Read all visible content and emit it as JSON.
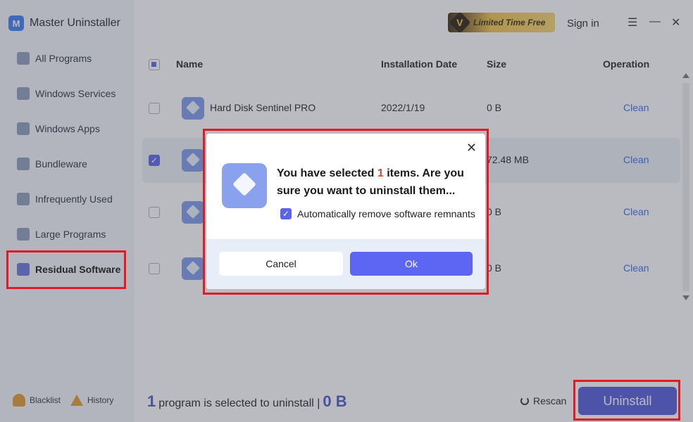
{
  "app": {
    "title": "Master Uninstaller",
    "logo_letter": "M",
    "accent_color": "#5b63e6",
    "highlight_color": "#e01b24"
  },
  "sidebar": {
    "items": [
      {
        "label": "All Programs",
        "icon": "monitor-icon"
      },
      {
        "label": "Windows Services",
        "icon": "windows-icon"
      },
      {
        "label": "Windows Apps",
        "icon": "grid-icon"
      },
      {
        "label": "Bundleware",
        "icon": "link-icon"
      },
      {
        "label": "Infrequently Used",
        "icon": "trash-icon"
      },
      {
        "label": "Large Programs",
        "icon": "folder-icon"
      },
      {
        "label": "Residual Software",
        "icon": "box-icon",
        "active": true
      }
    ],
    "blacklist_label": "Blacklist",
    "history_label": "History"
  },
  "topbar": {
    "promo_badge": "V",
    "promo_label": "Limited Time Free",
    "signin_label": "Sign in",
    "menu_glyph": "☰",
    "minimize_glyph": "—",
    "close_glyph": "✕"
  },
  "table": {
    "columns": {
      "name": "Name",
      "date": "Installation Date",
      "size": "Size",
      "operation": "Operation"
    },
    "rows": [
      {
        "name": "Hard Disk Sentinel PRO",
        "date": "2022/1/19",
        "size": "0 B",
        "action": "Clean",
        "checked": false
      },
      {
        "name": "",
        "date": "",
        "size": "72.48 MB",
        "action": "Clean",
        "checked": true
      },
      {
        "name": "",
        "date": "",
        "size": "0 B",
        "action": "Clean",
        "checked": false
      },
      {
        "name": "",
        "date": "",
        "size": "0 B",
        "action": "Clean",
        "checked": false
      }
    ]
  },
  "footer": {
    "count": "1",
    "text": "program is selected to uninstall |",
    "size": "0 B",
    "rescan_label": "Rescan",
    "uninstall_label": "Uninstall"
  },
  "dialog": {
    "msg_prefix": "You have selected ",
    "msg_count": "1",
    "msg_suffix": " items. Are you sure you want to uninstall them...",
    "checkbox_label": "Automatically remove software remnants",
    "checkbox_checked": true,
    "cancel_label": "Cancel",
    "ok_label": "Ok",
    "close_glyph": "✕"
  }
}
